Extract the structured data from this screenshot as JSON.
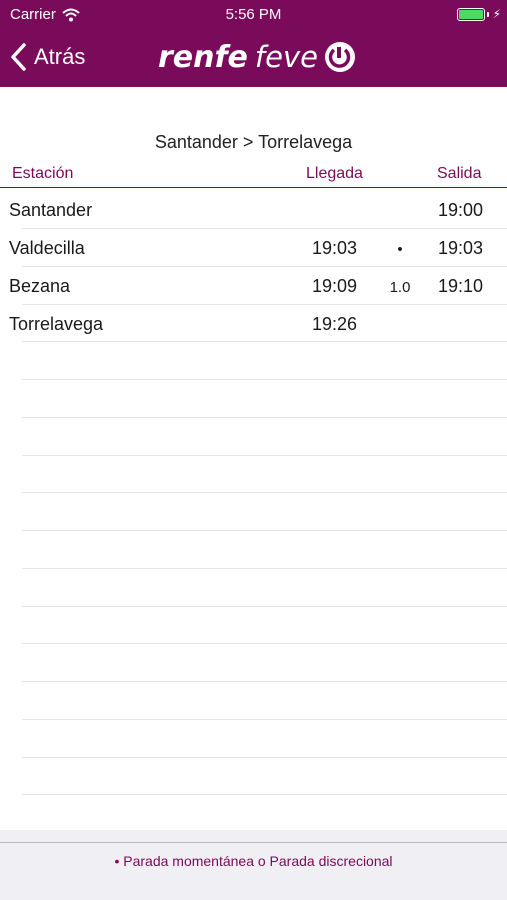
{
  "status": {
    "carrier": "Carrier",
    "time": "5:56 PM"
  },
  "nav": {
    "back_label": "Atrás",
    "logo_renfe": "renfe",
    "logo_feve": "feve"
  },
  "route": {
    "title": "Santander > Torrelavega"
  },
  "columns": {
    "station": "Estación",
    "arrival": "Llegada",
    "departure": "Salida"
  },
  "rows": [
    {
      "station": "Santander",
      "arrival": "",
      "mid": "",
      "departure": "19:00"
    },
    {
      "station": "Valdecilla",
      "arrival": "19:03",
      "mid": "•",
      "departure": "19:03"
    },
    {
      "station": "Bezana",
      "arrival": "19:09",
      "mid": "1.0",
      "departure": "19:10"
    },
    {
      "station": "Torrelavega",
      "arrival": "19:26",
      "mid": "",
      "departure": ""
    }
  ],
  "footer": {
    "legend": "• Parada momentánea  o Parada discrecional"
  },
  "colors": {
    "brand": "#7a0a5a",
    "battery": "#4cd964"
  }
}
